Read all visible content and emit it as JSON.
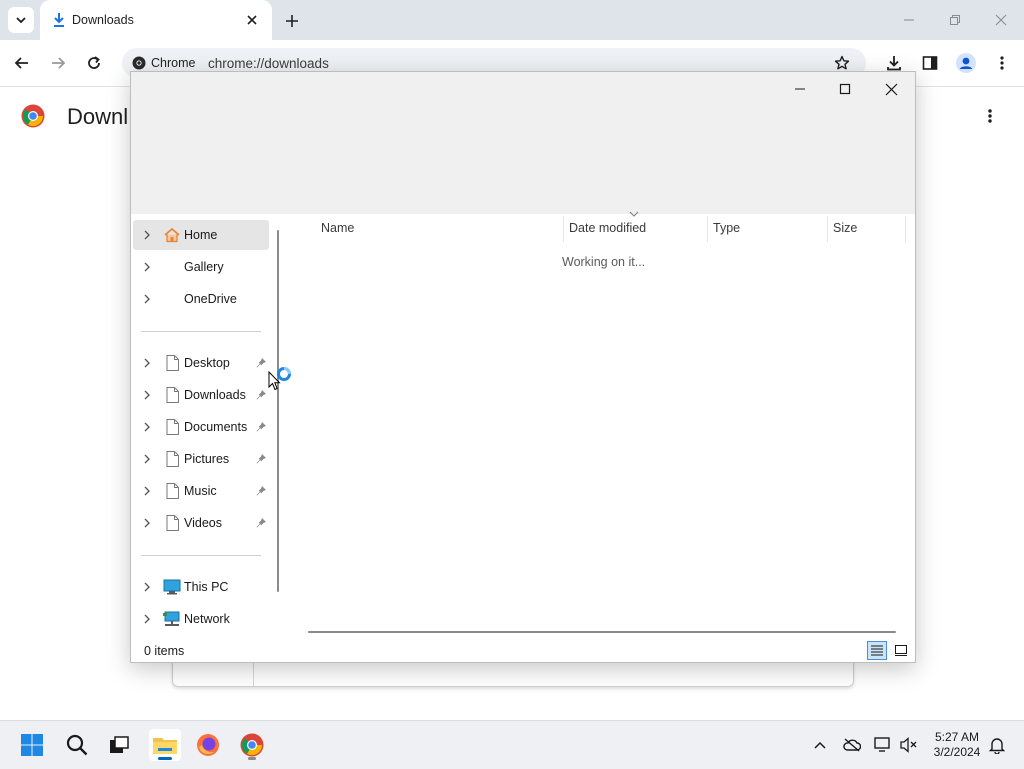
{
  "browser": {
    "tab": {
      "title": "Downloads"
    },
    "omnibox": {
      "chip_label": "Chrome",
      "url": "chrome://downloads"
    }
  },
  "page": {
    "title": "Downl"
  },
  "dialog": {
    "nav": {
      "quick": [
        {
          "label": "Home",
          "icon": "home-icon",
          "selected": true
        },
        {
          "label": "Gallery",
          "icon": "",
          "selected": false
        },
        {
          "label": "OneDrive",
          "icon": "",
          "selected": false
        }
      ],
      "pinned": [
        {
          "label": "Desktop",
          "icon": "file-icon",
          "pinned": true
        },
        {
          "label": "Downloads",
          "icon": "file-icon",
          "pinned": true
        },
        {
          "label": "Documents",
          "icon": "file-icon",
          "pinned": true
        },
        {
          "label": "Pictures",
          "icon": "file-icon",
          "pinned": true
        },
        {
          "label": "Music",
          "icon": "file-icon",
          "pinned": true
        },
        {
          "label": "Videos",
          "icon": "file-icon",
          "pinned": true
        }
      ],
      "locations": [
        {
          "label": "This PC",
          "icon": "monitor-icon"
        },
        {
          "label": "Network",
          "icon": "network-icon"
        }
      ]
    },
    "columns": [
      "Name",
      "Date modified",
      "Type",
      "Size"
    ],
    "status_message": "Working on it...",
    "item_count": "0 items"
  },
  "taskbar": {
    "apps": [
      "start-icon",
      "search-icon",
      "task-view-icon",
      "file-explorer-icon",
      "firefox-icon",
      "chrome-icon"
    ],
    "clock": {
      "time": "5:27 AM",
      "date": "3/2/2024"
    }
  },
  "colors": {
    "accent": "#0067c0",
    "folder_yellow": "#f2c14e",
    "home_orange": "#e8833a"
  }
}
